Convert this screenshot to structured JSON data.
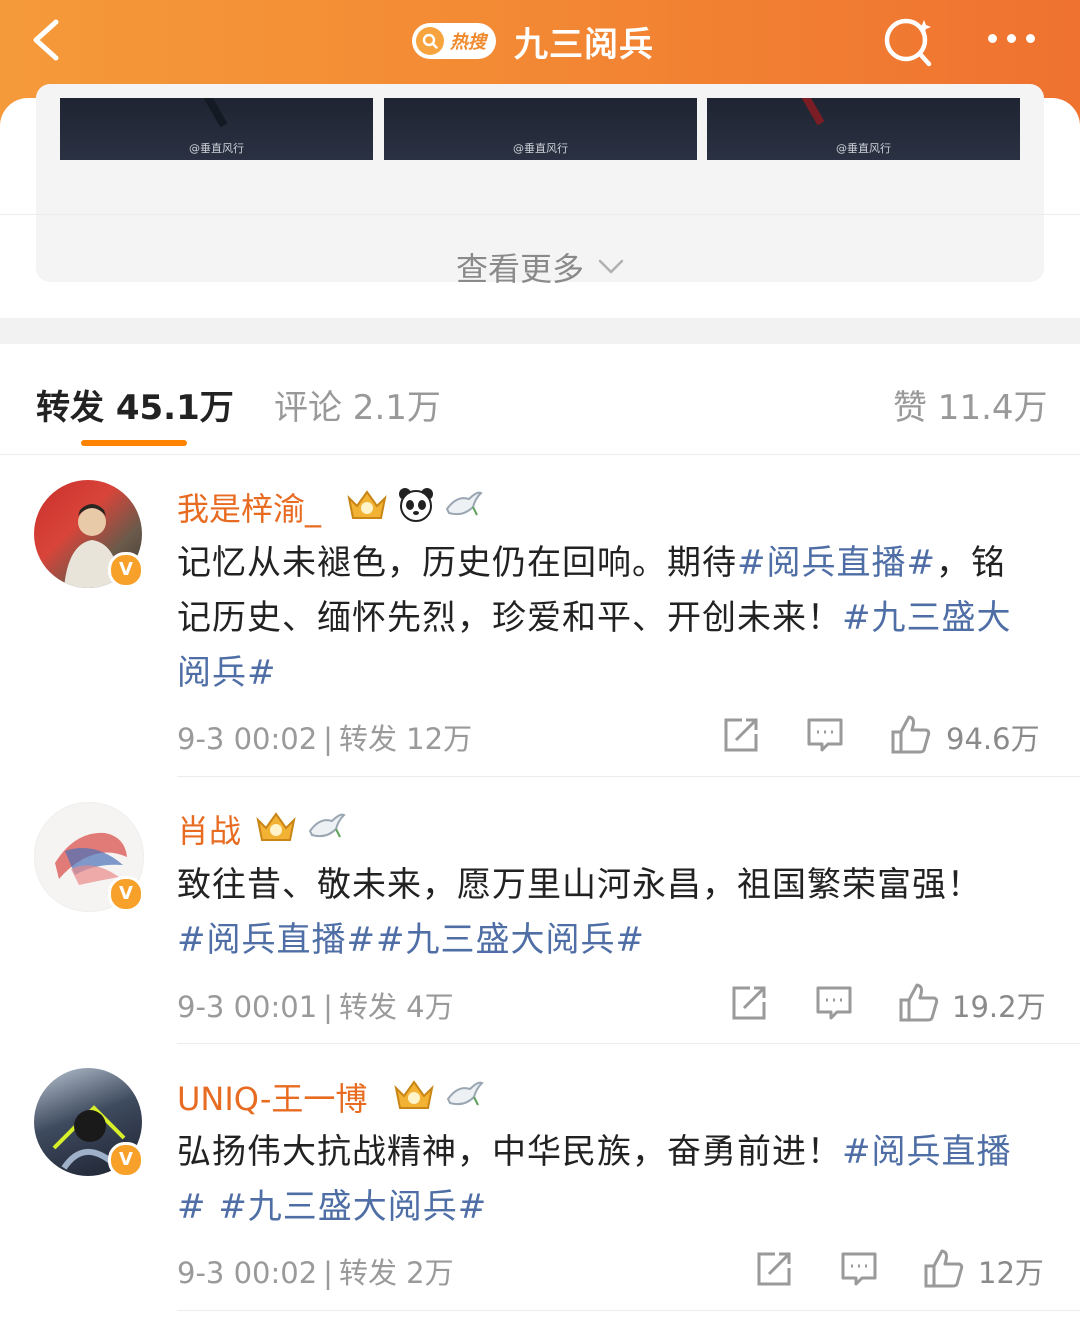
{
  "header": {
    "hot_badge": "热搜",
    "title": "九三阅兵",
    "back_icon": "chevron-left-icon",
    "search_icon": "search-icon",
    "more_icon": "more-dots-icon"
  },
  "thumbnails": [
    {
      "watermark": "@垂直风行"
    },
    {
      "watermark": "@垂直风行"
    },
    {
      "watermark": "@垂直风行"
    }
  ],
  "see_more": {
    "label": "查看更多"
  },
  "tabs": [
    {
      "label": "转发 45.1万",
      "active": true
    },
    {
      "label": "评论 2.1万",
      "active": false
    },
    {
      "label": "赞 11.4万",
      "active": false
    }
  ],
  "posts": [
    {
      "name": "我是梓渝_",
      "badge": "V",
      "text_plain": "记忆从未褪色，历史仍在回响。期待",
      "tag1": "#阅兵直播#",
      "text_mid": "，铭记历史、缅怀先烈，珍爱和平、开创未来！",
      "tag2": "#九三盛大阅兵#",
      "time": "9-3 00:02",
      "reposts": "转发 12万",
      "likes": "94.6万"
    },
    {
      "name": "肖战",
      "badge": "V",
      "text_plain": "致往昔、敬未来，愿万里山河永昌，祖国繁荣富强！",
      "tag1": "#阅兵直播#",
      "text_mid": "",
      "tag2": "#九三盛大阅兵#",
      "time": "9-3 00:01",
      "reposts": "转发 4万",
      "likes": "19.2万"
    },
    {
      "name": "UNIQ-王一博",
      "badge": "V",
      "text_plain": "弘扬伟大抗战精神，中华民族，奋勇前进！",
      "tag1": "#阅兵直播#",
      "text_mid": " ",
      "tag2": "#九三盛大阅兵#",
      "time": "9-3 00:02",
      "reposts": "转发 2万",
      "likes": "12万"
    }
  ],
  "colors": {
    "header_start": "#f59a3a",
    "header_end": "#ef7230",
    "name": "#e86b22",
    "hashtag": "#4e6ea5",
    "tab_underline": "#ff8200",
    "v_badge": "#f7a12a"
  }
}
